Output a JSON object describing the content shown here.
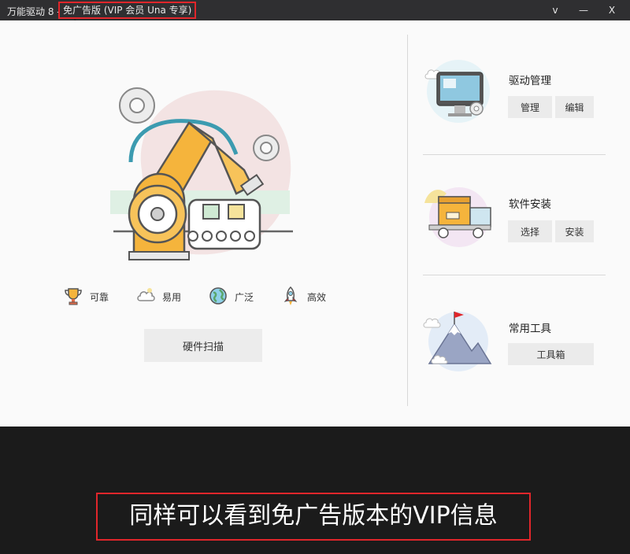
{
  "titlebar": {
    "app_title": "万能驱动 8  -",
    "edition": "免广告版 (VIP 会员 Una 专享)",
    "buttons": {
      "dropdown": "v",
      "minimize": "—",
      "close": "X"
    }
  },
  "features": [
    {
      "label": "可靠",
      "icon": "trophy-icon"
    },
    {
      "label": "易用",
      "icon": "cloud-icon"
    },
    {
      "label": "广泛",
      "icon": "globe-icon"
    },
    {
      "label": "高效",
      "icon": "rocket-icon"
    }
  ],
  "scan_button": "硬件扫描",
  "sections": {
    "driver": {
      "title": "驱动管理",
      "buttons": [
        "管理",
        "编辑"
      ]
    },
    "software": {
      "title": "软件安装",
      "buttons": [
        "选择",
        "安装"
      ]
    },
    "tools": {
      "title": "常用工具",
      "buttons": [
        "工具箱"
      ]
    }
  },
  "caption": "同样可以看到免广告版本的VIP信息",
  "colors": {
    "highlight": "#e0262b",
    "accent": "#f5b43c",
    "titlebar": "#2f2f31"
  }
}
